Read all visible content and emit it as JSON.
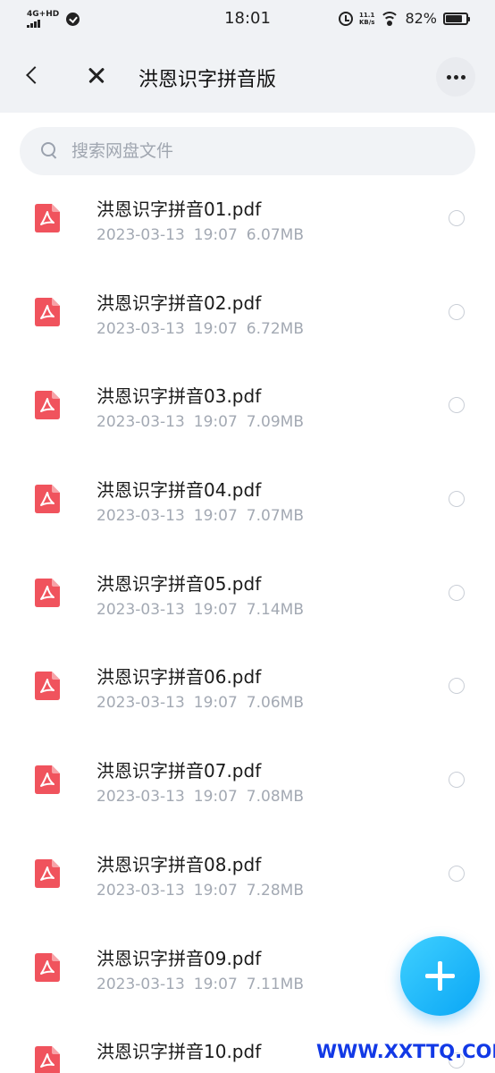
{
  "status_bar": {
    "network": "4G+HD",
    "time": "18:01",
    "speed_value": "11.1",
    "speed_unit": "KB/s",
    "battery": "82%"
  },
  "header": {
    "title": "洪恩识字拼音版"
  },
  "search": {
    "placeholder": "搜索网盘文件"
  },
  "files": [
    {
      "name": "洪恩识字拼音01.pdf",
      "date": "2023-03-13",
      "time": "19:07",
      "size": "6.07MB"
    },
    {
      "name": "洪恩识字拼音02.pdf",
      "date": "2023-03-13",
      "time": "19:07",
      "size": "6.72MB"
    },
    {
      "name": "洪恩识字拼音03.pdf",
      "date": "2023-03-13",
      "time": "19:07",
      "size": "7.09MB"
    },
    {
      "name": "洪恩识字拼音04.pdf",
      "date": "2023-03-13",
      "time": "19:07",
      "size": "7.07MB"
    },
    {
      "name": "洪恩识字拼音05.pdf",
      "date": "2023-03-13",
      "time": "19:07",
      "size": "7.14MB"
    },
    {
      "name": "洪恩识字拼音06.pdf",
      "date": "2023-03-13",
      "time": "19:07",
      "size": "7.06MB"
    },
    {
      "name": "洪恩识字拼音07.pdf",
      "date": "2023-03-13",
      "time": "19:07",
      "size": "7.08MB"
    },
    {
      "name": "洪恩识字拼音08.pdf",
      "date": "2023-03-13",
      "time": "19:07",
      "size": "7.28MB"
    },
    {
      "name": "洪恩识字拼音09.pdf",
      "date": "2023-03-13",
      "time": "19:07",
      "size": "7.11MB"
    },
    {
      "name": "洪恩识字拼音10.pdf",
      "date": "",
      "time": "",
      "size": ""
    }
  ],
  "watermark": "WWW.XXTTQ.COM",
  "colors": {
    "header_bg": "#f0f2f5",
    "pdf_red": "#f0535d",
    "fab_blue": "#0aa6f5",
    "watermark_blue": "#1239e6"
  },
  "icons": {
    "back": "chevron-left-icon",
    "close": "close-icon",
    "more": "more-dots-icon",
    "search": "search-icon",
    "file": "pdf-file-icon",
    "fab": "plus-icon"
  }
}
